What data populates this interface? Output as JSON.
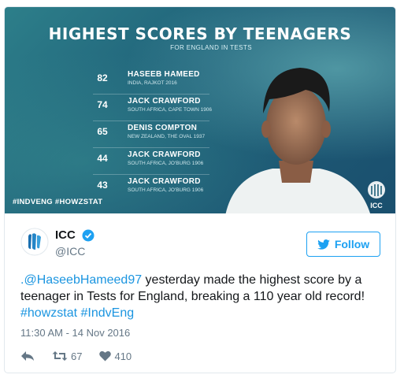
{
  "graphic": {
    "title": "HIGHEST SCORES BY TEENAGERS",
    "subtitle": "FOR ENGLAND IN TESTS",
    "rows": [
      {
        "score": "82",
        "name": "HASEEB HAMEED",
        "place": "INDIA, RAJKOT 2016"
      },
      {
        "score": "74",
        "name": "JACK CRAWFORD",
        "place": "SOUTH AFRICA, CAPE TOWN 1906"
      },
      {
        "score": "65",
        "name": "DENIS COMPTON",
        "place": "NEW ZEALAND, THE OVAL 1937"
      },
      {
        "score": "44",
        "name": "JACK CRAWFORD",
        "place": "SOUTH AFRICA, JO'BURG 1906"
      },
      {
        "score": "43",
        "name": "JACK CRAWFORD",
        "place": "SOUTH AFRICA, JO'BURG 1906"
      }
    ],
    "hashtags": "#INDVENG #HOWZSTAT",
    "logo_text": "ICC"
  },
  "tweet": {
    "display_name": "ICC",
    "handle": "@ICC",
    "follow_label": "Follow",
    "mention": ".@HaseebHameed97",
    "text_part1": " yesterday made the highest score by a teenager in Tests for England, breaking a 110 year old record! ",
    "hashtag1": "#howzstat",
    "hashtag2": "#IndvEng",
    "timestamp": "11:30 AM - 14 Nov 2016",
    "retweets": "67",
    "likes": "410"
  },
  "colors": {
    "accent": "#1da1f2",
    "link": "#1b95e0",
    "muted": "#657786",
    "graphic_bg": "#1f5f78"
  },
  "icons": [
    "icc-logo-icon",
    "verified-icon",
    "twitter-bird-icon",
    "reply-icon",
    "retweet-icon",
    "heart-icon"
  ]
}
